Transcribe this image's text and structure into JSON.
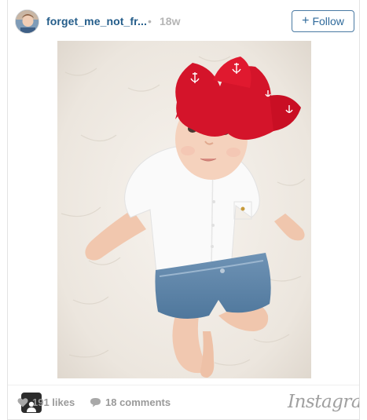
{
  "header": {
    "username": "forget_me_not_fr...",
    "separator": "•",
    "time_ago": "18w",
    "follow_plus": "+",
    "follow_label": "Follow"
  },
  "footer": {
    "likes_label": "191 likes",
    "comments_label": "18 comments",
    "brand": "Instagram"
  },
  "colors": {
    "username": "#245d8a",
    "follow_border": "#4a7aa3",
    "meta_gray": "#9a9a9a",
    "headband_red": "#d4142a"
  },
  "icons": {
    "like": "heart-icon",
    "comment": "comment-bubble-icon",
    "tag": "person-tag-icon"
  }
}
